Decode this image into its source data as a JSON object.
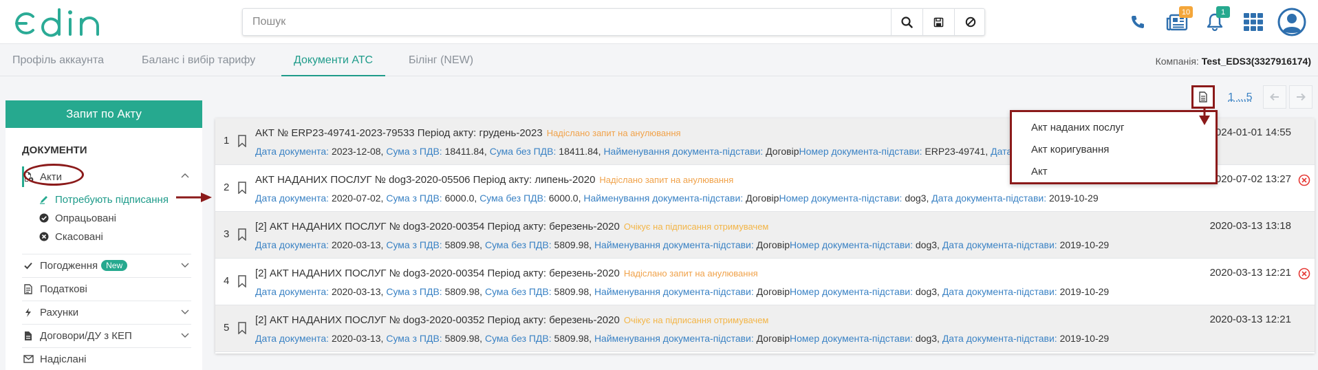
{
  "header": {
    "logo_text": "edin",
    "search": {
      "placeholder": "Пошук"
    },
    "badges": {
      "documents": "10",
      "notifications": "1"
    }
  },
  "tabs": [
    {
      "label": "Профіль аккаунта"
    },
    {
      "label": "Баланс і вибір тарифу"
    },
    {
      "label": "Документи АТС"
    },
    {
      "label": "Білінг (NEW)"
    }
  ],
  "company": {
    "label": "Компанія:",
    "value": "Test_EDS3(3327916174)"
  },
  "sidebar": {
    "request_button": "Запит по Акту",
    "heading": "ДОКУМЕНТИ",
    "acts": "Акти",
    "sub": {
      "need_sign": "Потребують підписання",
      "processed": "Опрацьовані",
      "cancelled": "Скасовані"
    },
    "approvals": "Погодження",
    "new_badge": "New",
    "tax": "Податкові",
    "invoices": "Рахунки",
    "contracts": "Договори/ДУ з КЕП",
    "sent": "Надіслані"
  },
  "pager": {
    "label": "1 ...5"
  },
  "dropdown": {
    "items": [
      "Акт наданих послуг",
      "Акт коригування",
      "Акт"
    ]
  },
  "labels": {
    "doc_date": "Дата документа:",
    "sum_vat": "Сума з ПДВ:",
    "sum_no_vat": "Сума без ПДВ:",
    "basis_name": "Найменування документа-підстави:",
    "basis_number": "Номер документа-підстави:",
    "basis_date": "Дата документа-підстави:"
  },
  "rows": [
    {
      "num": "1",
      "title": "АКТ   № ERP23-49741-2023-79533   Період акту: грудень-2023",
      "status": "Надіслано запит на анулювання",
      "doc_date": "2023-12-08,",
      "sum_vat": "18411.84,",
      "sum_no_vat": "18411.84,",
      "basis_name": "Договір",
      "basis_number": "ERP23-49741,",
      "basis_date": "",
      "date": "2024-01-01 14:55"
    },
    {
      "num": "2",
      "title": "АКТ НАДАНИХ ПОСЛУГ   № dog3-2020-05506   Період акту: липень-2020",
      "status": "Надіслано запит на анулювання",
      "doc_date": "2020-07-02,",
      "sum_vat": "6000.0,",
      "sum_no_vat": "6000.0,",
      "basis_name": "Договір",
      "basis_number": "dog3,",
      "basis_date": "2019-10-29",
      "date": "2020-07-02 13:27"
    },
    {
      "num": "3",
      "title": "[2] АКТ НАДАНИХ ПОСЛУГ   № dog3-2020-00354   Період акту: березень-2020",
      "status": "Очікує на підписання отримувачем",
      "doc_date": "2020-03-13,",
      "sum_vat": "5809.98,",
      "sum_no_vat": "5809.98,",
      "basis_name": "Договір",
      "basis_number": "dog3,",
      "basis_date": "2019-10-29",
      "date": "2020-03-13 13:18"
    },
    {
      "num": "4",
      "title": "[2] АКТ НАДАНИХ ПОСЛУГ   № dog3-2020-00354   Період акту: березень-2020",
      "status": "Надіслано запит на анулювання",
      "doc_date": "2020-03-13,",
      "sum_vat": "5809.98,",
      "sum_no_vat": "5809.98,",
      "basis_name": "Договір",
      "basis_number": "dog3,",
      "basis_date": "2019-10-29",
      "date": "2020-03-13 12:21"
    },
    {
      "num": "5",
      "title": "[2] АКТ НАДАНИХ ПОСЛУГ   № dog3-2020-00352   Період акту: березень-2020",
      "status": "Очікує на підписання отримувачем",
      "doc_date": "2020-03-13,",
      "sum_vat": "5809.98,",
      "sum_no_vat": "5809.98,",
      "basis_name": "Договір",
      "basis_number": "dog3,",
      "basis_date": "2019-10-29",
      "date": "2020-03-13 12:21"
    }
  ],
  "colors": {
    "accent": "#26a98f",
    "link": "#3a82c4",
    "status_orange": "#f0a24a",
    "annotation": "#8b1a1a",
    "danger": "#e53935"
  }
}
